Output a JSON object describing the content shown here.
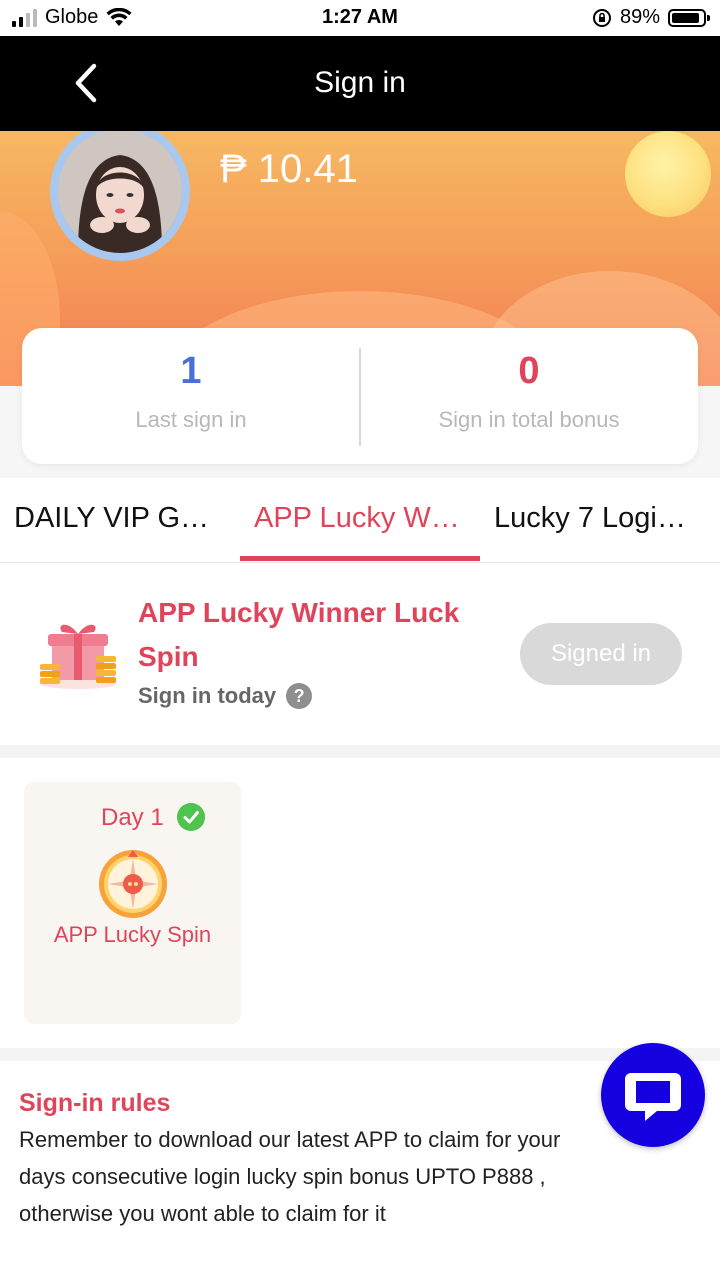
{
  "status_bar": {
    "carrier": "Globe",
    "time": "1:27 AM",
    "battery": "89%"
  },
  "nav": {
    "title": "Sign in",
    "back_icon": "chevron-left-icon"
  },
  "profile": {
    "balance": "₱ 10.41",
    "avatar_icon": "avatar"
  },
  "stats": [
    {
      "value": "1",
      "label": "Last sign in",
      "color": "#4a6fd8"
    },
    {
      "value": "0",
      "label": "Sign in total bonus",
      "color": "#e0445a"
    }
  ],
  "tabs": [
    {
      "label": "DAILY VIP G…"
    },
    {
      "label": "APP Lucky W…",
      "active": true
    },
    {
      "label": "Lucky 7 Logi…"
    }
  ],
  "event": {
    "title": "APP Lucky Winner Luck Spin",
    "subtitle": "Sign in today",
    "help_icon": "?",
    "button": "Signed in"
  },
  "days": [
    {
      "day": "Day 1",
      "name": "APP Lucky Spin",
      "checked": true
    }
  ],
  "rules": {
    "title": "Sign-in rules",
    "lines": [
      "Remember to download our latest APP to claim for your",
      "days consecutive login lucky spin bonus UPTO P888 ,",
      "otherwise you wont able to claim for it"
    ]
  },
  "colors": {
    "accent": "#e0445a",
    "stat_blue": "#4a6fd8",
    "fab": "#1500e0"
  }
}
